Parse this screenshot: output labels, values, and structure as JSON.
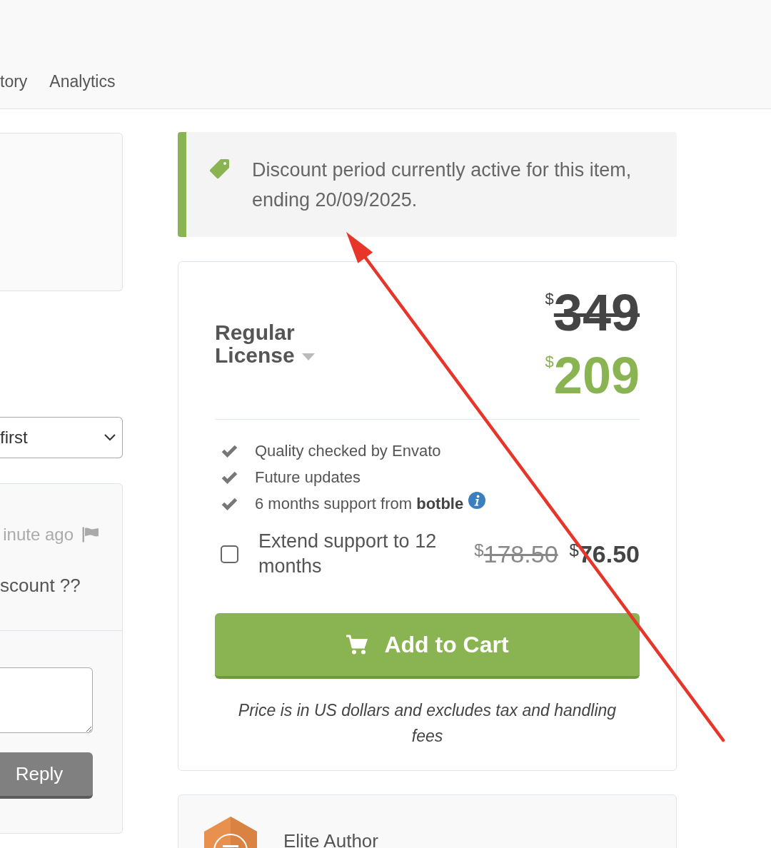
{
  "nav": {
    "links": [
      "tory",
      "Analytics"
    ]
  },
  "sort_select": {
    "value": "first"
  },
  "comment": {
    "time": "inute ago",
    "text": "scount ??"
  },
  "reply": {
    "button": "Reply"
  },
  "discount_notice": {
    "text": "Discount period currently active for this item, ending 20/09/2025."
  },
  "license": {
    "name": "Regular License",
    "old_currency": "$",
    "old_price": "349",
    "currency": "$",
    "price": "209"
  },
  "features": [
    {
      "text": "Quality checked by Envato",
      "info": false
    },
    {
      "text": "Future updates",
      "info": false
    },
    {
      "text": "6 months support from **botble**",
      "info": true
    }
  ],
  "extend_support": {
    "label": "Extend support to 12 months",
    "checked": false,
    "old_currency": "$",
    "old_price": "178.50",
    "currency": "$",
    "price": "76.50"
  },
  "add_to_cart": {
    "label": "Add to Cart"
  },
  "price_note": "Price is in US dollars and excludes tax and handling fees",
  "author_badge": {
    "label": "Elite Author"
  }
}
